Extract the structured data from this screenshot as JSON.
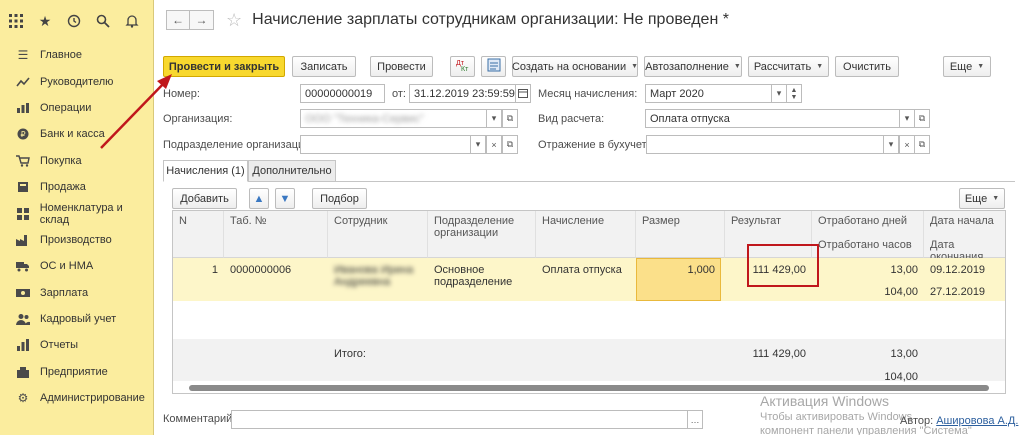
{
  "sidebar": {
    "top_icons": [
      "apps-grid-icon",
      "star-icon",
      "history-icon",
      "search-icon",
      "bell-icon"
    ],
    "items": [
      {
        "label": "Главное",
        "icon": "menu-icon"
      },
      {
        "label": "Руководителю",
        "icon": "trend-icon"
      },
      {
        "label": "Операции",
        "icon": "operations-icon"
      },
      {
        "label": "Банк и касса",
        "icon": "coin-icon"
      },
      {
        "label": "Покупка",
        "icon": "cart-icon"
      },
      {
        "label": "Продажа",
        "icon": "sale-icon"
      },
      {
        "label": "Номенклатура и склад",
        "icon": "warehouse-icon"
      },
      {
        "label": "Производство",
        "icon": "factory-icon"
      },
      {
        "label": "ОС и НМА",
        "icon": "truck-icon"
      },
      {
        "label": "Зарплата",
        "icon": "salary-icon"
      },
      {
        "label": "Кадровый учет",
        "icon": "people-icon"
      },
      {
        "label": "Отчеты",
        "icon": "chart-icon"
      },
      {
        "label": "Предприятие",
        "icon": "enterprise-icon"
      },
      {
        "label": "Администрирование",
        "icon": "gear-icon"
      }
    ]
  },
  "header": {
    "title": "Начисление зарплаты сотрудникам организации: Не проведен *"
  },
  "toolbar": {
    "post_close": "Провести и закрыть",
    "write": "Записать",
    "post": "Провести",
    "create_based": "Создать на основании",
    "autofill": "Автозаполнение",
    "calculate": "Рассчитать",
    "clear": "Очистить",
    "more": "Еще"
  },
  "form": {
    "number_label": "Номер:",
    "number_value": "00000000019",
    "from_label": "от:",
    "date_value": "31.12.2019 23:59:59",
    "month_label": "Месяц начисления:",
    "month_value": "Март 2020",
    "org_label": "Организация:",
    "org_value": "ООО \"Техника-Сервис\"",
    "calc_type_label": "Вид расчета:",
    "calc_type_value": "Оплата отпуска",
    "division_label": "Подразделение организации:",
    "accounting_label": "Отражение в бухучете:"
  },
  "tabs": {
    "accruals": "Начисления (1)",
    "additional": "Дополнительно"
  },
  "table_toolbar": {
    "add": "Добавить",
    "pick": "Подбор",
    "more": "Еще"
  },
  "table": {
    "headers": {
      "n": "N",
      "tab_no": "Таб. №",
      "employee": "Сотрудник",
      "division": "Подразделение организации",
      "accrual": "Начисление",
      "size": "Размер",
      "result": "Результат",
      "days": "Отработано дней",
      "hours": "Отработано часов",
      "date_start": "Дата начала",
      "date_end": "Дата окончания"
    },
    "row": {
      "n": "1",
      "tab_no": "0000000006",
      "employee": "Иванова Ирина Андреевна",
      "division": "Основное подразделение",
      "accrual": "Оплата отпуска",
      "size": "1,000",
      "result": "111 429,00",
      "days": "13,00",
      "hours": "104,00",
      "date_start": "09.12.2019",
      "date_end": "27.12.2019"
    },
    "totals": {
      "label": "Итого:",
      "result": "111 429,00",
      "days": "13,00",
      "hours": "104,00"
    }
  },
  "footer": {
    "comment_label": "Комментарий:",
    "author_label": "Автор:",
    "author_name": "Ашировова А.Д."
  },
  "watermark": {
    "line1": "Активация Windows",
    "line2": "Чтобы активировать Windows",
    "line3": "компонент панели управления \"Система\""
  },
  "colors": {
    "sidebar_bg": "#fbed9e",
    "primary_button": "#f8d82e",
    "highlight_border": "#c0171c",
    "arrow": "#c0171c",
    "row_bg": "#fdf6c9"
  }
}
